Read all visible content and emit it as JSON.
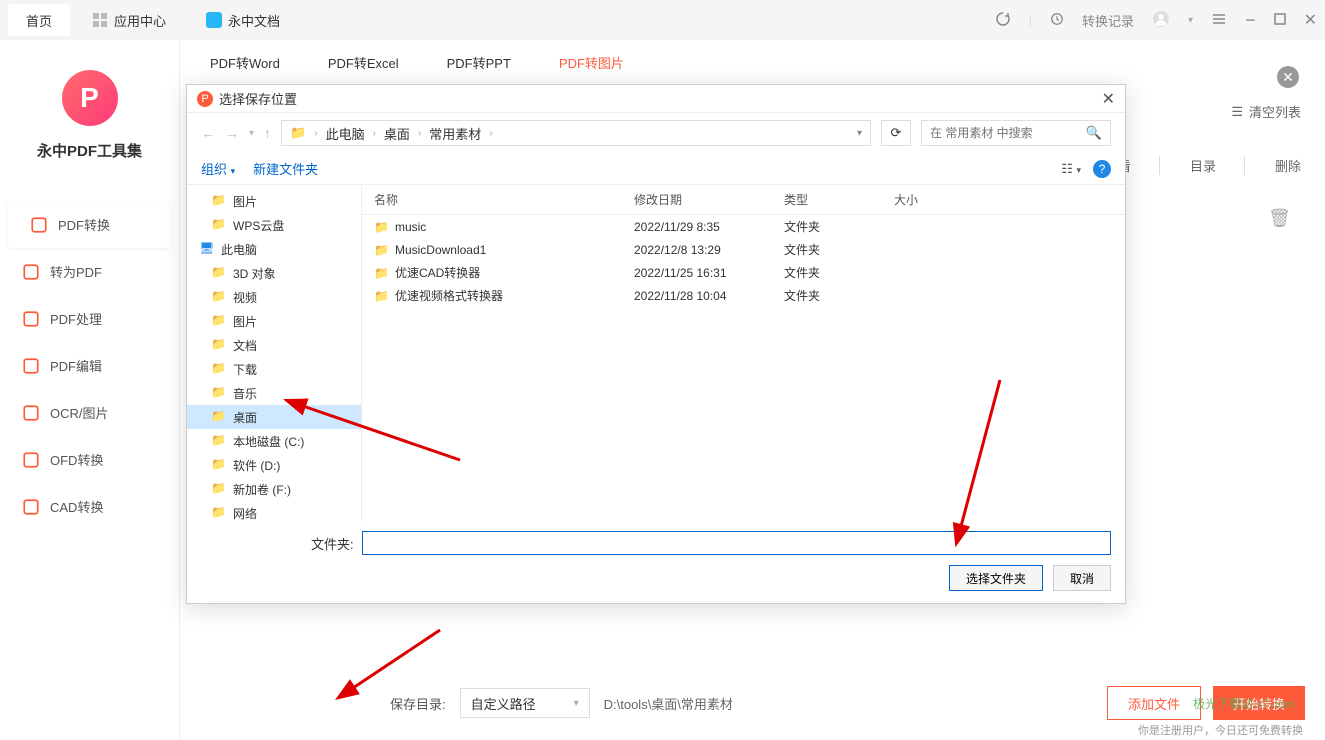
{
  "topTabs": {
    "home": "首页",
    "appCenter": "应用中心",
    "doc": "永中文档"
  },
  "topRight": {
    "history": "转换记录"
  },
  "subTabs": {
    "word": "PDF转Word",
    "excel": "PDF转Excel",
    "ppt": "PDF转PPT",
    "image": "PDF转图片"
  },
  "sidebar": {
    "title": "永中PDF工具集",
    "items": [
      "PDF转换",
      "转为PDF",
      "PDF处理",
      "PDF编辑",
      "OCR/图片",
      "OFD转换",
      "CAD转换"
    ]
  },
  "toolbar": {
    "clearList": "清空列表",
    "view": "查看",
    "catalog": "目录",
    "delete": "删除"
  },
  "dialog": {
    "title": "选择保存位置",
    "crumbs": [
      "此电脑",
      "桌面",
      "常用素材"
    ],
    "searchPlaceholder": "在 常用素材 中搜索",
    "organize": "组织",
    "newFolder": "新建文件夹",
    "columns": {
      "name": "名称",
      "date": "修改日期",
      "type": "类型",
      "size": "大小"
    },
    "tree": [
      "图片",
      "WPS云盘",
      "此电脑",
      "3D 对象",
      "视频",
      "图片",
      "文档",
      "下载",
      "音乐",
      "桌面",
      "本地磁盘 (C:)",
      "软件 (D:)",
      "新加卷 (F:)",
      "网络"
    ],
    "treeSelectedIndex": 9,
    "files": [
      {
        "name": "music",
        "date": "2022/11/29 8:35",
        "type": "文件夹"
      },
      {
        "name": "MusicDownload1",
        "date": "2022/12/8 13:29",
        "type": "文件夹"
      },
      {
        "name": "优速CAD转换器",
        "date": "2022/11/25 16:31",
        "type": "文件夹"
      },
      {
        "name": "优速视频格式转换器",
        "date": "2022/11/28 10:04",
        "type": "文件夹"
      }
    ],
    "folderLabel": "文件夹:",
    "selectBtn": "选择文件夹",
    "cancelBtn": "取消"
  },
  "bottom": {
    "saveDirLabel": "保存目录:",
    "saveDirValue": "自定义路径",
    "pathText": "D:\\tools\\桌面\\常用素材",
    "addFile": "添加文件",
    "start": "开始转换",
    "footnote": "你是注册用户，今日还可免费转换"
  },
  "watermark": "极光下载站 x7.com"
}
